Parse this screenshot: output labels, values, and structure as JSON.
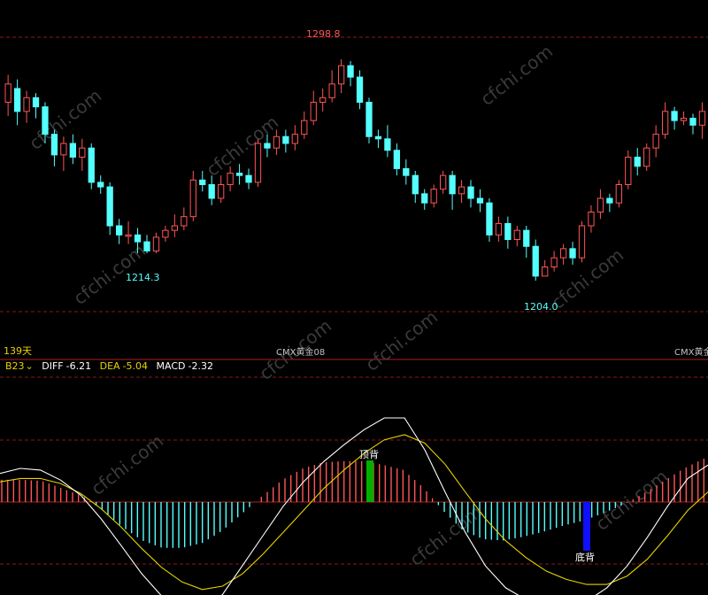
{
  "colors": {
    "up": "#ff5555",
    "down": "#54ffff",
    "grid": "#8b1a1a",
    "axis": "#b02020",
    "diff_line": "#ffffff",
    "dea_line": "#e6d300",
    "top_div_bar": "#00b000",
    "bottom_div_bar": "#1010ff",
    "label_gold": "#e6d300"
  },
  "header": {
    "period_label": "139天",
    "symbol_center": "CMX黄金08",
    "symbol_right": "CMX黄金"
  },
  "indicator_bar": {
    "name": "B23",
    "dropdown_icon": "chevron-down-icon",
    "diff_label": "DIFF",
    "diff_value": "-6.21",
    "dea_label": "DEA",
    "dea_value": "-5.04",
    "macd_label": "MACD",
    "macd_value": "-2.32"
  },
  "annotations": {
    "high_label": "1298.8",
    "low1_label": "1214.3",
    "low2_label": "1204.0",
    "top_divergence": "顶背",
    "bottom_divergence": "底背"
  },
  "watermark": "cfchi.com",
  "chart_data": {
    "type": "candlestick",
    "ylim": [
      1190,
      1310
    ],
    "candles": [
      [
        1280,
        1288,
        1274,
        1292
      ],
      [
        1286,
        1276,
        1270,
        1290
      ],
      [
        1276,
        1282,
        1271,
        1285
      ],
      [
        1282,
        1278,
        1273,
        1284
      ],
      [
        1278,
        1266,
        1262,
        1280
      ],
      [
        1266,
        1257,
        1252,
        1268
      ],
      [
        1257,
        1262,
        1250,
        1265
      ],
      [
        1262,
        1256,
        1253,
        1266
      ],
      [
        1256,
        1260,
        1250,
        1264
      ],
      [
        1260,
        1245,
        1242,
        1262
      ],
      [
        1245,
        1243,
        1240,
        1248
      ],
      [
        1243,
        1226,
        1222,
        1245
      ],
      [
        1226,
        1222,
        1218,
        1229
      ],
      [
        1222,
        1222,
        1218,
        1228
      ],
      [
        1222,
        1219,
        1214,
        1225
      ],
      [
        1219,
        1215,
        1214,
        1222
      ],
      [
        1215,
        1221,
        1214,
        1223
      ],
      [
        1221,
        1224,
        1219,
        1226
      ],
      [
        1224,
        1226,
        1221,
        1231
      ],
      [
        1226,
        1230,
        1224,
        1234
      ],
      [
        1230,
        1246,
        1228,
        1250
      ],
      [
        1246,
        1244,
        1241,
        1250
      ],
      [
        1244,
        1238,
        1235,
        1248
      ],
      [
        1238,
        1244,
        1236,
        1248
      ],
      [
        1244,
        1249,
        1241,
        1252
      ],
      [
        1249,
        1248,
        1244,
        1253
      ],
      [
        1248,
        1245,
        1242,
        1251
      ],
      [
        1245,
        1262,
        1243,
        1264
      ],
      [
        1262,
        1260,
        1256,
        1266
      ],
      [
        1260,
        1265,
        1257,
        1268
      ],
      [
        1265,
        1262,
        1258,
        1268
      ],
      [
        1262,
        1266,
        1259,
        1270
      ],
      [
        1266,
        1272,
        1264,
        1276
      ],
      [
        1272,
        1280,
        1270,
        1285
      ],
      [
        1280,
        1282,
        1276,
        1286
      ],
      [
        1282,
        1288,
        1280,
        1294
      ],
      [
        1288,
        1296,
        1284,
        1298.8
      ],
      [
        1296,
        1291,
        1287,
        1298
      ],
      [
        1291,
        1280,
        1277,
        1294
      ],
      [
        1280,
        1265,
        1262,
        1282
      ],
      [
        1265,
        1264,
        1260,
        1268
      ],
      [
        1264,
        1259,
        1256,
        1270
      ],
      [
        1259,
        1251,
        1248,
        1262
      ],
      [
        1251,
        1248,
        1244,
        1255
      ],
      [
        1248,
        1240,
        1236,
        1250
      ],
      [
        1240,
        1236,
        1233,
        1242
      ],
      [
        1236,
        1242,
        1234,
        1244
      ],
      [
        1242,
        1248,
        1240,
        1250
      ],
      [
        1248,
        1240,
        1233,
        1250
      ],
      [
        1240,
        1243,
        1236,
        1246
      ],
      [
        1243,
        1238,
        1234,
        1246
      ],
      [
        1238,
        1236,
        1232,
        1242
      ],
      [
        1236,
        1222,
        1219,
        1238
      ],
      [
        1222,
        1227,
        1219,
        1230
      ],
      [
        1227,
        1220,
        1216,
        1230
      ],
      [
        1220,
        1224,
        1217,
        1226
      ],
      [
        1224,
        1217,
        1212,
        1226
      ],
      [
        1217,
        1204,
        1202,
        1220
      ],
      [
        1204,
        1208,
        1204,
        1211
      ],
      [
        1208,
        1212,
        1206,
        1215
      ],
      [
        1212,
        1216,
        1209,
        1218
      ],
      [
        1216,
        1212,
        1209,
        1219
      ],
      [
        1212,
        1226,
        1210,
        1228
      ],
      [
        1226,
        1232,
        1223,
        1235
      ],
      [
        1232,
        1238,
        1229,
        1242
      ],
      [
        1238,
        1236,
        1232,
        1240
      ],
      [
        1236,
        1244,
        1234,
        1246
      ],
      [
        1244,
        1256,
        1242,
        1259
      ],
      [
        1256,
        1252,
        1248,
        1260
      ],
      [
        1252,
        1260,
        1250,
        1262
      ],
      [
        1260,
        1266,
        1256,
        1270
      ],
      [
        1266,
        1276,
        1264,
        1280
      ],
      [
        1276,
        1272,
        1268,
        1278
      ],
      [
        1272,
        1273,
        1270,
        1276
      ],
      [
        1273,
        1270,
        1266,
        1275
      ],
      [
        1270,
        1276,
        1264,
        1280
      ]
    ],
    "macd_diff": [
      0.34,
      0.4,
      0.38,
      0.26,
      0.08,
      -0.2,
      -0.52,
      -0.85,
      -1.12,
      -1.28,
      -1.3,
      -1.1,
      -0.75,
      -0.4,
      -0.05,
      0.24,
      0.48,
      0.68,
      0.86,
      1.0,
      1.0,
      0.62,
      0.12,
      -0.36,
      -0.76,
      -1.02,
      -1.16,
      -1.24,
      -1.25,
      -1.18,
      -1.02,
      -0.76,
      -0.42,
      -0.05,
      0.28,
      0.44
    ],
    "macd_dea": [
      0.24,
      0.28,
      0.28,
      0.22,
      0.1,
      -0.08,
      -0.3,
      -0.55,
      -0.78,
      -0.95,
      -1.04,
      -1.0,
      -0.85,
      -0.62,
      -0.36,
      -0.1,
      0.16,
      0.38,
      0.58,
      0.74,
      0.8,
      0.7,
      0.45,
      0.12,
      -0.2,
      -0.46,
      -0.66,
      -0.82,
      -0.92,
      -0.98,
      -0.98,
      -0.88,
      -0.68,
      -0.4,
      -0.1,
      0.12
    ],
    "macd_hist": [
      0.36,
      0.36,
      0.34,
      0.22,
      0.1,
      -0.12,
      -0.4,
      -0.62,
      -0.74,
      -0.74,
      -0.66,
      -0.46,
      -0.18,
      0.1,
      0.36,
      0.54,
      0.64,
      0.66,
      0.66,
      0.6,
      0.52,
      0.24,
      -0.14,
      -0.46,
      -0.6,
      -0.62,
      -0.56,
      -0.48,
      -0.38,
      -0.3,
      -0.18,
      -0.04,
      0.14,
      0.34,
      0.54,
      0.7
    ]
  }
}
